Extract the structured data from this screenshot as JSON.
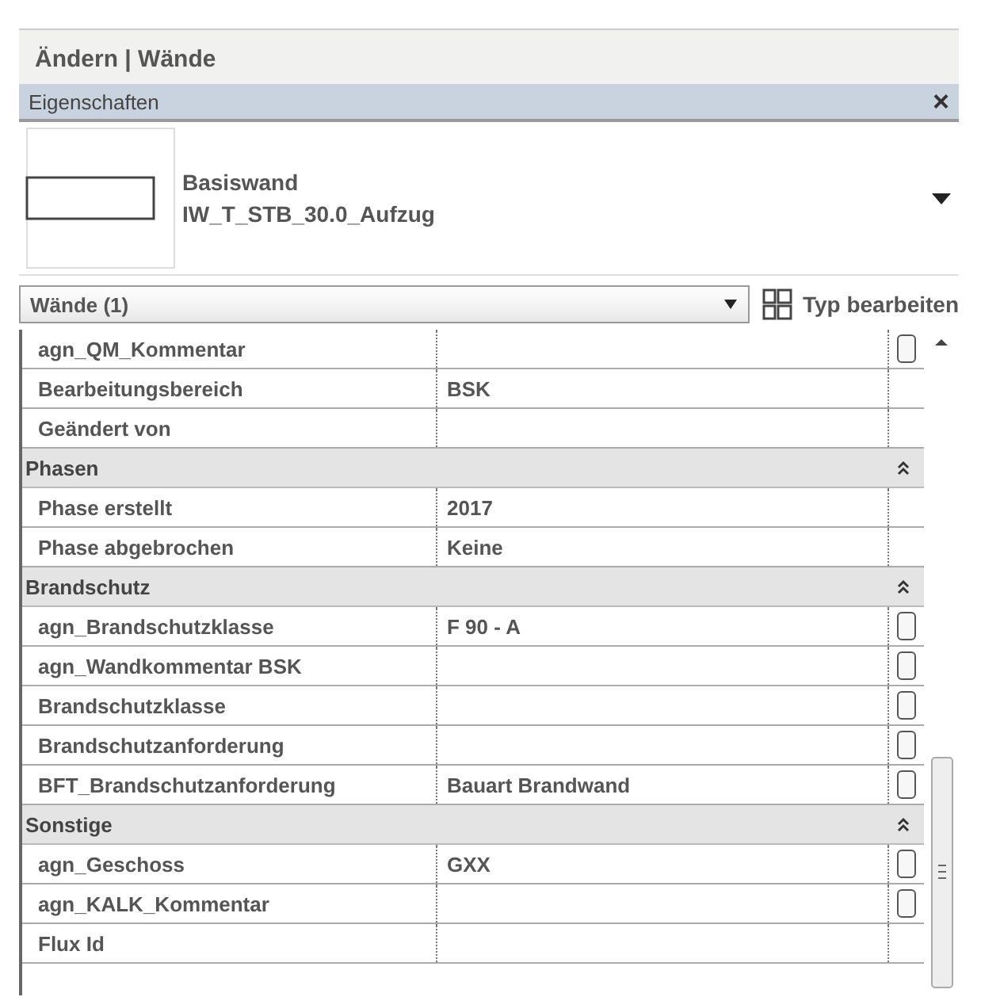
{
  "ribbon_context": "Ändern | Wände",
  "panel": {
    "title": "Eigenschaften",
    "close": "×"
  },
  "type_selector": {
    "family": "Basiswand",
    "type": "IW_T_STB_30.0_Aufzug"
  },
  "filter": {
    "value": "Wände (1)",
    "edit_type_button": "Typ bearbeiten"
  },
  "groups": [
    {
      "rows": [
        {
          "name": "agn_QM_Kommentar",
          "value": "",
          "has_button": true
        },
        {
          "name": "Bearbeitungsbereich",
          "value": "BSK",
          "has_button": false
        },
        {
          "name": "Geändert von",
          "value": "",
          "has_button": false
        }
      ]
    },
    {
      "name": "Phasen",
      "expanded": true,
      "rows": [
        {
          "name": "Phase erstellt",
          "value": "2017",
          "has_button": false
        },
        {
          "name": "Phase abgebrochen",
          "value": "Keine",
          "has_button": false
        }
      ]
    },
    {
      "name": "Brandschutz",
      "expanded": true,
      "rows": [
        {
          "name": "agn_Brandschutzklasse",
          "value": "F 90 - A",
          "has_button": true
        },
        {
          "name": "agn_Wandkommentar BSK",
          "value": "",
          "has_button": true
        },
        {
          "name": "Brandschutzklasse",
          "value": "",
          "has_button": true
        },
        {
          "name": "Brandschutzanforderung",
          "value": "",
          "has_button": true
        },
        {
          "name": "BFT_Brandschutzanforderung",
          "value": "Bauart Brandwand",
          "has_button": true
        }
      ]
    },
    {
      "name": "Sonstige",
      "expanded": true,
      "rows": [
        {
          "name": "agn_Geschoss",
          "value": "GXX",
          "has_button": true
        },
        {
          "name": "agn_KALK_Kommentar",
          "value": "",
          "has_button": true
        },
        {
          "name": "Flux Id",
          "value": "",
          "has_button": false
        }
      ]
    }
  ]
}
